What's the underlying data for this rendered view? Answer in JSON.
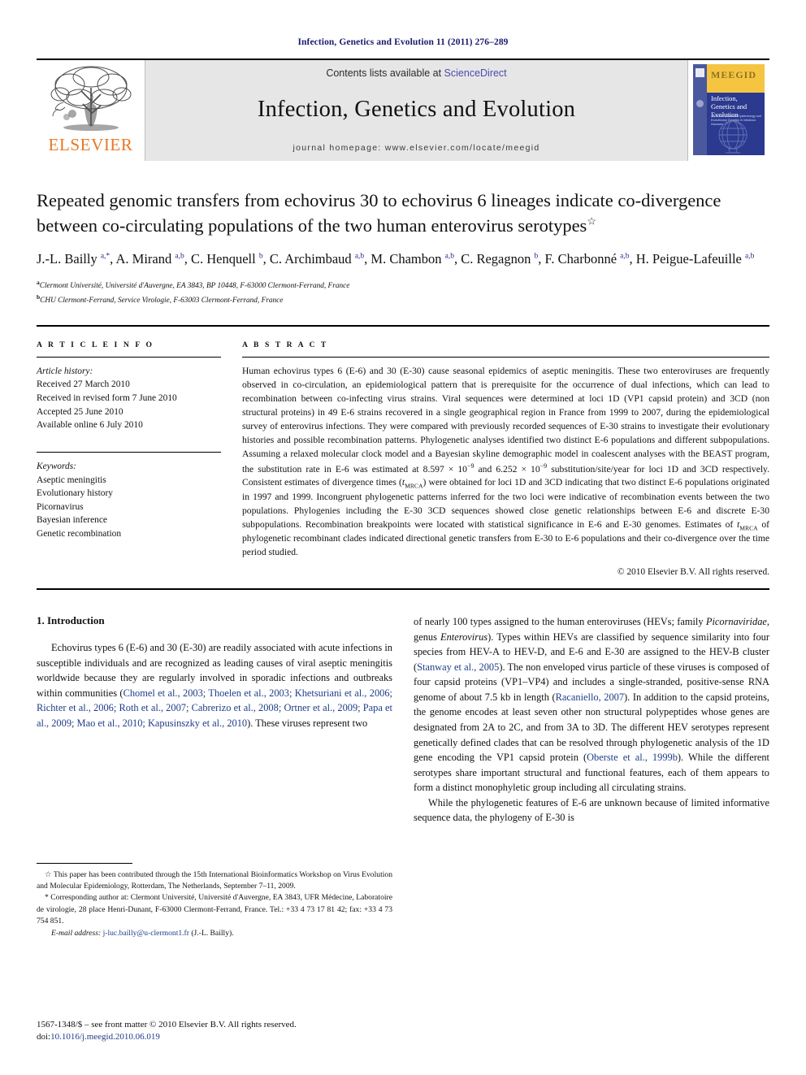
{
  "running_head": "Infection, Genetics and Evolution 11 (2011) 276–289",
  "masthead": {
    "contents_prefix": "Contents lists available at ",
    "sciencedirect": "ScienceDirect",
    "journal_title": "Infection, Genetics and Evolution",
    "homepage": "journal homepage: www.elsevier.com/locate/meegid",
    "publisher_logo_text": "ELSEVIER",
    "cover": {
      "band_title": "MEEGID",
      "journal_name": "Infection, Genetics and Evolution",
      "subtitle": "Journal of Molecular Epidemiology and Evolutionary Genetics in Infectious Diseases"
    },
    "colors": {
      "link": "#4a4ab5",
      "elsevier_orange": "#E87722",
      "band_bg": "#e6e6e6",
      "cover_blue": "#2b3a8f",
      "cover_yellow": "#f5c542"
    }
  },
  "article": {
    "title": "Repeated genomic transfers from echovirus 30 to echovirus 6 lineages indicate co-divergence between co-circulating populations of the two human enterovirus serotypes",
    "title_footnote_mark": "☆",
    "authors_html": "J.-L. Bailly <sup>a,*</sup>, A. Mirand <sup>a,b</sup>, C. Henquell <sup>b</sup>, C. Archimbaud <sup>a,b</sup>, M. Chambon <sup>a,b</sup>, C. Regagnon <sup>b</sup>, F. Charbonné <sup>a,b</sup>, H. Peigue-Lafeuille <sup>a,b</sup>",
    "affiliations": [
      {
        "mark": "a",
        "text": "Clermont Université, Université d'Auvergne, EA 3843, BP 10448, F-63000 Clermont-Ferrand, France"
      },
      {
        "mark": "b",
        "text": "CHU Clermont-Ferrand, Service Virologie, F-63003 Clermont-Ferrand, France"
      }
    ]
  },
  "article_info": {
    "heading": "A R T I C L E   I N F O",
    "history_label": "Article history:",
    "history": [
      "Received 27 March 2010",
      "Received in revised form 7 June 2010",
      "Accepted 25 June 2010",
      "Available online 6 July 2010"
    ],
    "keywords_label": "Keywords:",
    "keywords": [
      "Aseptic meningitis",
      "Evolutionary history",
      "Picornavirus",
      "Bayesian inference",
      "Genetic recombination"
    ]
  },
  "abstract": {
    "heading": "A B S T R A C T",
    "paragraph_html": "Human echovirus types 6 (E-6) and 30 (E-30) cause seasonal epidemics of aseptic meningitis. These two enteroviruses are frequently observed in co-circulation, an epidemiological pattern that is prerequisite for the occurrence of dual infections, which can lead to recombination between co-infecting virus strains. Viral sequences were determined at loci 1D (VP1 capsid protein) and 3CD (non structural proteins) in 49 E-6 strains recovered in a single geographical region in France from 1999 to 2007, during the epidemiological survey of enterovirus infections. They were compared with previously recorded sequences of E-30 strains to investigate their evolutionary histories and possible recombination patterns. Phylogenetic analyses identified two distinct E-6 populations and different subpopulations. Assuming a relaxed molecular clock model and a Bayesian skyline demographic model in coalescent analyses with the BEAST program, the substitution rate in E-6 was estimated at 8.597 × 10<sup>−9</sup> and 6.252 × 10<sup>−9</sup> substitution/site/year for loci 1D and 3CD respectively. Consistent estimates of divergence times (<span class=\"ital\">t</span><sub>MRCA</sub>) were obtained for loci 1D and 3CD indicating that two distinct E-6 populations originated in 1997 and 1999. Incongruent phylogenetic patterns inferred for the two loci were indicative of recombination events between the two populations. Phylogenies including the E-30 3CD sequences showed close genetic relationships between E-6 and discrete E-30 subpopulations. Recombination breakpoints were located with statistical significance in E-6 and E-30 genomes. Estimates of <span class=\"ital\">t</span><sub>MRCA</sub> of phylogenetic recombinant clades indicated directional genetic transfers from E-30 to E-6 populations and their co-divergence over the time period studied.",
    "copyright": "© 2010 Elsevier B.V. All rights reserved."
  },
  "introduction": {
    "heading": "1. Introduction",
    "left_paragraph_html": "Echovirus types 6 (E-6) and 30 (E-30) are readily associated with acute infections in susceptible individuals and are recognized as leading causes of viral aseptic meningitis worldwide because they are regularly involved in sporadic infections and outbreaks within communities (<span class=\"cite\">Chomel et al., 2003; Thoelen et al., 2003; Khetsuriani et al., 2006; Richter et al., 2006; Roth et al., 2007; Cabrerizo et al., 2008; Ortner et al., 2009; Papa et al., 2009; Mao et al., 2010; Kapusinszky et al., 2010</span>). These viruses represent two",
    "right_paragraph_1_html": "of nearly 100 types assigned to the human enteroviruses (HEVs; family <span class=\"ital\">Picornaviridae</span>, genus <span class=\"ital\">Enterovirus</span>). Types within HEVs are classified by sequence similarity into four species from HEV-A to HEV-D, and E-6 and E-30 are assigned to the HEV-B cluster (<span class=\"cite\">Stanway et al., 2005</span>). The non enveloped virus particle of these viruses is composed of four capsid proteins (VP1–VP4) and includes a single-stranded, positive-sense RNA genome of about 7.5 kb in length (<span class=\"cite\">Racaniello, 2007</span>). In addition to the capsid proteins, the genome encodes at least seven other non structural polypeptides whose genes are designated from 2A to 2C, and from 3A to 3D. The different HEV serotypes represent genetically defined clades that can be resolved through phylogenetic analysis of the 1D gene encoding the VP1 capsid protein (<span class=\"cite\">Oberste et al., 1999b</span>). While the different serotypes share important structural and functional features, each of them appears to form a distinct monophyletic group including all circulating strains.",
    "right_paragraph_2_html": "While the phylogenetic features of E-6 are unknown because of limited informative sequence data, the phylogeny of E-30 is"
  },
  "footnotes": {
    "star_note_html": "<span class=\"mark\">☆</span> This paper has been contributed through the 15th International Bioinformatics Workshop on Virus Evolution and Molecular Epidemiology, Rotterdam, The Netherlands, September 7–11, 2009.",
    "corresponding_html": "<span class=\"mark\">*</span> Corresponding author at: Clermont Université, Université d'Auvergne, EA 3843, UFR Médecine, Laboratoire de virologie, 28 place Henri-Dunant, F-63000 Clermont-Ferrand, France. Tel.: +33 4 73 17 81 42; fax: +33 4 73 754 851.",
    "email_label": "E-mail address:",
    "email": "j-luc.bailly@u-clermont1.fr",
    "email_owner": "(J.-L. Bailly)."
  },
  "page_footer": {
    "issn_line": "1567-1348/$ – see front matter © 2010 Elsevier B.V. All rights reserved.",
    "doi_label": "doi:",
    "doi_value": "10.1016/j.meegid.2010.06.019"
  }
}
